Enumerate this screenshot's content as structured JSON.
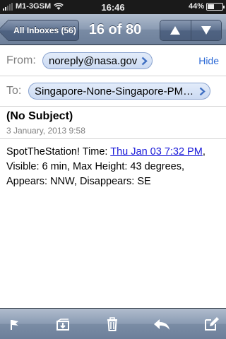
{
  "status_bar": {
    "carrier": "M1-3GSM",
    "time": "16:46",
    "battery_percent_label": "44%",
    "battery_level": 0.44
  },
  "nav": {
    "back_label": "All Inboxes (56)",
    "position_label": "16 of 80",
    "prev_icon": "up-arrow-icon",
    "next_icon": "down-arrow-icon"
  },
  "header": {
    "from_label": "From:",
    "from_value": "noreply@nasa.gov",
    "hide_label": "Hide",
    "to_label": "To:",
    "to_value": "Singapore-None-Singapore-PM…",
    "subject": "(No Subject)",
    "date": "3 January, 2013 9:58"
  },
  "message": {
    "prefix": "SpotTheStation! Time: ",
    "link_text": "Thu Jan 03 7:32 PM",
    "suffix": ", Visible: 6 min, Max Height: 43 degrees, Appears: NNW, Disappears: SE"
  },
  "toolbar": {
    "icons": [
      "flag-icon",
      "move-folder-icon",
      "trash-icon",
      "reply-icon",
      "compose-icon"
    ]
  },
  "colors": {
    "link": "#1a1ad8",
    "hide_link": "#2d6ad6",
    "bubble_border": "#8aa3cf"
  }
}
